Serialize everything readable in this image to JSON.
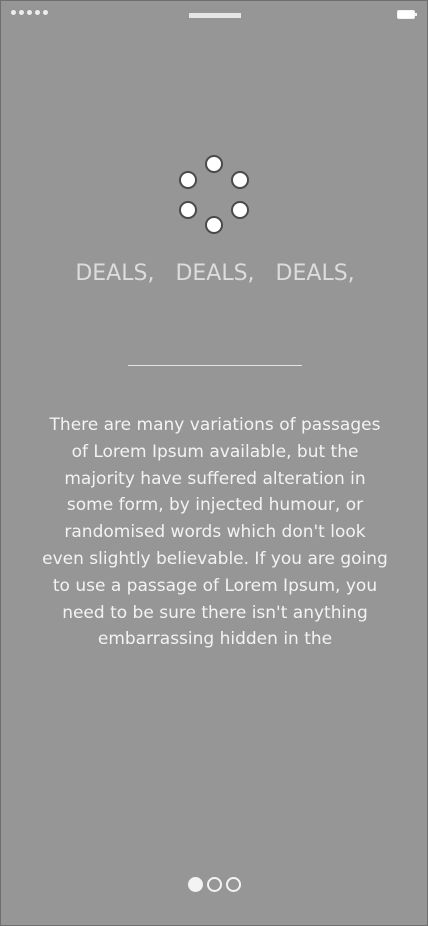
{
  "status_bar": {
    "signal_dots": 5,
    "battery_icon": "battery-icon"
  },
  "loader": {
    "icon": "loading-spinner-icon",
    "dots": 6
  },
  "headline": {
    "words": [
      "DEALS,",
      "DEALS,",
      "DEALS,"
    ]
  },
  "body": {
    "lines": [
      "There are many variations of passages",
      "of Lorem Ipsum available, but the",
      "majority have suffered alteration in",
      "some form, by injected humour, or",
      "randomised words which don't look",
      "even slightly believable. If you are going",
      "to use a passage of Lorem Ipsum, you",
      "need to be sure there isn't anything",
      "embarrassing hidden in the"
    ]
  },
  "pager": {
    "total": 3,
    "active_index": 0
  },
  "colors": {
    "background": "#969696",
    "text": "#f3f3f3",
    "headline": "#dcdcdc"
  }
}
